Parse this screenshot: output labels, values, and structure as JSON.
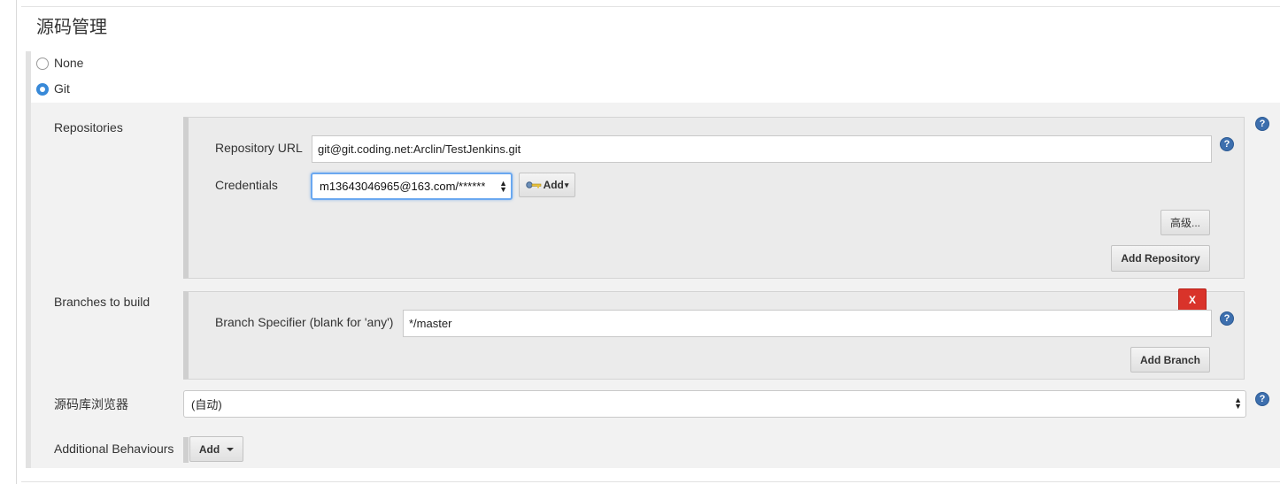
{
  "section": {
    "title": "源码管理"
  },
  "scm_options": [
    {
      "label": "None",
      "selected": false
    },
    {
      "label": "Git",
      "selected": true
    }
  ],
  "repositories": {
    "label": "Repositories",
    "url_label": "Repository URL",
    "url_value": "git@git.coding.net:Arclin/TestJenkins.git",
    "credentials_label": "Credentials",
    "credentials_value": "m13643046965@163.com/******",
    "add_credentials_label": "Add",
    "advanced_label": "高级...",
    "add_repository_label": "Add Repository"
  },
  "branches": {
    "label": "Branches to build",
    "delete_label": "X",
    "specifier_label": "Branch Specifier (blank for 'any')",
    "specifier_value": "*/master",
    "add_branch_label": "Add Branch"
  },
  "browser": {
    "label": "源码库浏览器",
    "value": "(自动)"
  },
  "additional": {
    "label": "Additional Behaviours",
    "add_label": "Add"
  },
  "help_icon_glyph": "?",
  "colors": {
    "accent": "#3889d8",
    "delete": "#d9332a",
    "help": "#3d6fae"
  }
}
